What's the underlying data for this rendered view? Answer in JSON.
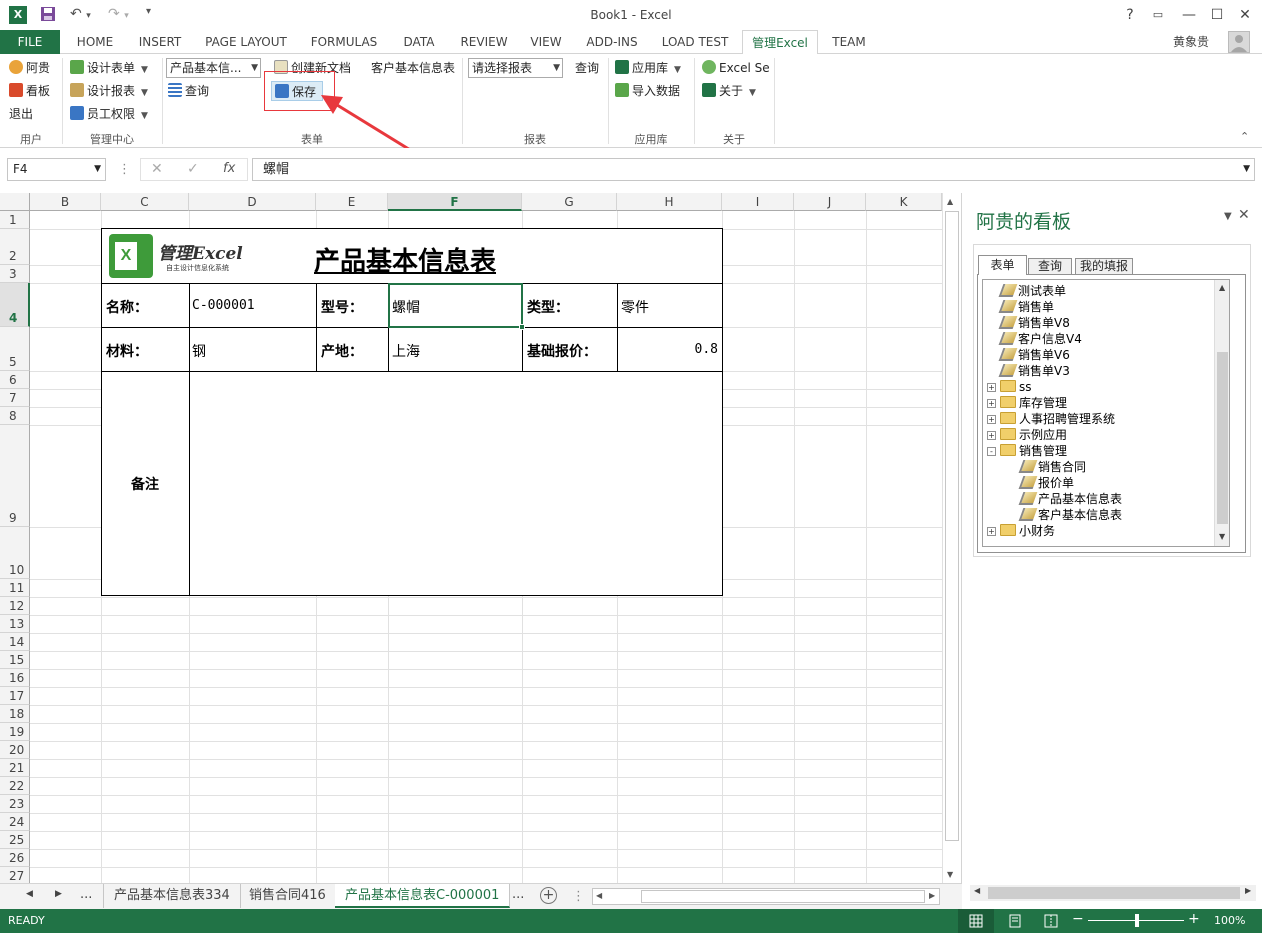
{
  "app": {
    "window_title": "Book1 - Excel",
    "user_name": "黄象贵"
  },
  "tabs": [
    "FILE",
    "HOME",
    "INSERT",
    "PAGE LAYOUT",
    "FORMULAS",
    "DATA",
    "REVIEW",
    "VIEW",
    "ADD-INS",
    "LOAD TEST",
    "管理Excel",
    "TEAM"
  ],
  "ribbon": {
    "user_group": {
      "label": "用户",
      "items": [
        "阿贵",
        "看板",
        "退出"
      ]
    },
    "manage_group": {
      "label": "管理中心",
      "items": [
        "设计表单",
        "设计报表",
        "员工权限"
      ]
    },
    "form_group": {
      "label": "表单",
      "combo_value": "产品基本信...",
      "new_doc": "创建新文档",
      "query": "查询",
      "save": "保存",
      "customer_info": "客户基本信息表"
    },
    "report_group": {
      "label": "报表",
      "combo_value": "请选择报表",
      "query": "查询"
    },
    "applib_group": {
      "label": "应用库",
      "app_store": "应用库",
      "import": "导入数据"
    },
    "about_group": {
      "label": "关于",
      "excel_se": "Excel Se",
      "about": "关于"
    }
  },
  "formula_bar": {
    "name_box": "F4",
    "formula": "螺帽"
  },
  "grid": {
    "columns": [
      "B",
      "C",
      "D",
      "E",
      "F",
      "G",
      "H",
      "I",
      "J",
      "K"
    ],
    "selected_column": "F",
    "rows": [
      "1",
      "2",
      "3",
      "4",
      "5",
      "6",
      "7",
      "8",
      "9",
      "10",
      "11",
      "12",
      "13",
      "14",
      "15",
      "16",
      "17",
      "18",
      "19",
      "20",
      "21",
      "22",
      "23",
      "24",
      "25",
      "26",
      "27"
    ],
    "selected_row": "4"
  },
  "form": {
    "logo_text": "管理Excel",
    "logo_subtitle": "自主设计信息化系统",
    "title": "产品基本信息表",
    "name_label": "名称：",
    "name_value": "C-000001",
    "model_label": "型号：",
    "model_value": "螺帽",
    "type_label": "类型：",
    "type_value": "零件",
    "material_label": "材料：",
    "material_value": "钢",
    "origin_label": "产地：",
    "origin_value": "上海",
    "price_label": "基础报价：",
    "price_value": "0.8",
    "remark_label": "备注"
  },
  "task_pane": {
    "title": "阿贵的看板",
    "tabs": [
      "表单",
      "查询",
      "我的填报"
    ],
    "tree": [
      {
        "label": "测试表单",
        "type": "form",
        "level": 1
      },
      {
        "label": "销售单",
        "type": "form",
        "level": 1
      },
      {
        "label": "销售单V8",
        "type": "form",
        "level": 1
      },
      {
        "label": "客户信息V4",
        "type": "form",
        "level": 1
      },
      {
        "label": "销售单V6",
        "type": "form",
        "level": 1
      },
      {
        "label": "销售单V3",
        "type": "form",
        "level": 1
      },
      {
        "label": "ss",
        "type": "folder",
        "level": 0,
        "expander": "+"
      },
      {
        "label": "库存管理",
        "type": "folder",
        "level": 0,
        "expander": "+"
      },
      {
        "label": "人事招聘管理系统",
        "type": "folder",
        "level": 0,
        "expander": "+"
      },
      {
        "label": "示例应用",
        "type": "folder",
        "level": 0,
        "expander": "+"
      },
      {
        "label": "销售管理",
        "type": "folder",
        "level": 0,
        "expander": "-"
      },
      {
        "label": "销售合同",
        "type": "form",
        "level": 2
      },
      {
        "label": "报价单",
        "type": "form",
        "level": 2
      },
      {
        "label": "产品基本信息表",
        "type": "form",
        "level": 2
      },
      {
        "label": "客户基本信息表",
        "type": "form",
        "level": 2
      },
      {
        "label": "小财务",
        "type": "folder",
        "level": 0,
        "expander": "+"
      }
    ]
  },
  "sheets": {
    "tabs": [
      "产品基本信息表334",
      "销售合同416",
      "产品基本信息表C-000001"
    ],
    "active": "产品基本信息表C-000001",
    "ellipsis": "..."
  },
  "status": {
    "mode": "READY",
    "zoom": "100%"
  },
  "colors": {
    "excel_green": "#217346",
    "annotation_red": "#e8383d"
  }
}
